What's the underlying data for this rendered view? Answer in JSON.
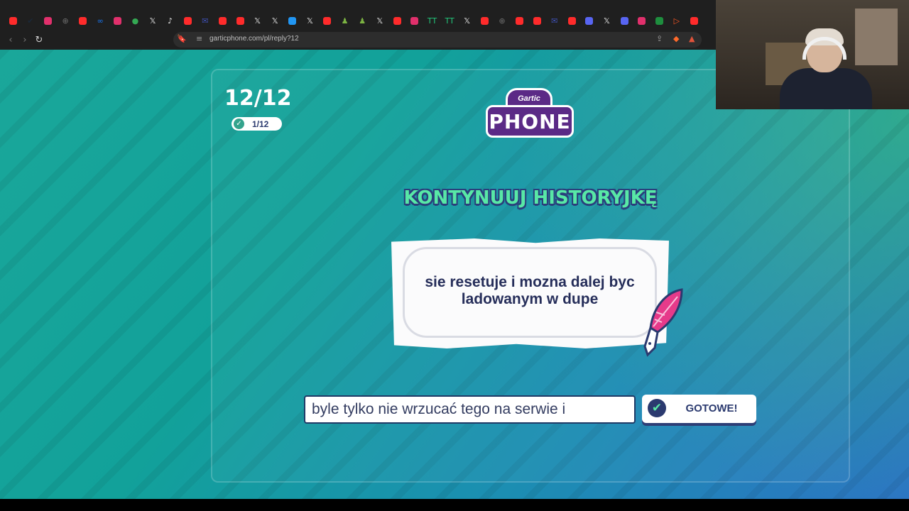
{
  "browser": {
    "url": "garticphone.com/pl/reply?12",
    "tab_favicons": [
      {
        "name": "youtube",
        "color": "#ff2b2b",
        "glyph": ""
      },
      {
        "name": "steam",
        "color": "#1b2838",
        "glyph": "✔"
      },
      {
        "name": "instagram",
        "color": "#e1306c",
        "glyph": ""
      },
      {
        "name": "globe",
        "color": "#6b6b6b",
        "glyph": "⊕"
      },
      {
        "name": "youtube",
        "color": "#ff2b2b",
        "glyph": ""
      },
      {
        "name": "meta",
        "color": "#1877f2",
        "glyph": "∞"
      },
      {
        "name": "instagram",
        "color": "#e1306c",
        "glyph": ""
      },
      {
        "name": "maps",
        "color": "#34a853",
        "glyph": "●"
      },
      {
        "name": "x",
        "color": "",
        "glyph": "𝕏"
      },
      {
        "name": "tiktok",
        "color": "",
        "glyph": "♪"
      },
      {
        "name": "youtube",
        "color": "#ff2b2b",
        "glyph": ""
      },
      {
        "name": "mail",
        "color": "#3f51b5",
        "glyph": "✉"
      },
      {
        "name": "youtube",
        "color": "#ff2b2b",
        "glyph": ""
      },
      {
        "name": "youtube",
        "color": "#ff2b2b",
        "glyph": ""
      },
      {
        "name": "x",
        "color": "",
        "glyph": "𝕏"
      },
      {
        "name": "x",
        "color": "",
        "glyph": "𝕏"
      },
      {
        "name": "app",
        "color": "#2196f3",
        "glyph": ""
      },
      {
        "name": "x",
        "color": "",
        "glyph": "𝕏"
      },
      {
        "name": "youtube",
        "color": "#ff2b2b",
        "glyph": ""
      },
      {
        "name": "chess",
        "color": "#7cb342",
        "glyph": "♟"
      },
      {
        "name": "chess",
        "color": "#7cb342",
        "glyph": "♟"
      },
      {
        "name": "x",
        "color": "",
        "glyph": "𝕏"
      },
      {
        "name": "youtube",
        "color": "#ff2b2b",
        "glyph": ""
      },
      {
        "name": "instagram",
        "color": "#e1306c",
        "glyph": ""
      },
      {
        "name": "tt",
        "color": "#22c77a",
        "glyph": "TT"
      },
      {
        "name": "tt",
        "color": "#22c77a",
        "glyph": "TT"
      },
      {
        "name": "x",
        "color": "",
        "glyph": "𝕏"
      },
      {
        "name": "youtube",
        "color": "#ff2b2b",
        "glyph": ""
      },
      {
        "name": "globe",
        "color": "#6b6b6b",
        "glyph": "⊕"
      },
      {
        "name": "youtube",
        "color": "#ff2b2b",
        "glyph": ""
      },
      {
        "name": "youtube",
        "color": "#ff2b2b",
        "glyph": ""
      },
      {
        "name": "mail",
        "color": "#3f51b5",
        "glyph": "✉"
      },
      {
        "name": "youtube",
        "color": "#ff2b2b",
        "glyph": ""
      },
      {
        "name": "discord",
        "color": "#5865f2",
        "glyph": ""
      },
      {
        "name": "x",
        "color": "",
        "glyph": "𝕏"
      },
      {
        "name": "discord",
        "color": "#5865f2",
        "glyph": ""
      },
      {
        "name": "instagram",
        "color": "#e1306c",
        "glyph": ""
      },
      {
        "name": "sheets",
        "color": "#1e8e3e",
        "glyph": ""
      },
      {
        "name": "play",
        "color": "#ff5722",
        "glyph": "▷"
      },
      {
        "name": "youtube",
        "color": "#ff2b2b",
        "glyph": ""
      }
    ]
  },
  "game": {
    "round": "12/12",
    "done_count": "1/12",
    "logo_top": "Gartic",
    "logo_bottom": "PHONE",
    "heading": "KONTYNUUJ HISTORYJKĘ",
    "prompt": "sie resetuje i mozna dalej byc ladowanym w dupe",
    "answer_value": "byle tylko nie wrzucać tego na serwie i",
    "done_button": "GOTOWE!"
  },
  "colors": {
    "accent_green": "#58e8a6",
    "navy": "#2b3a6f",
    "logo_purple": "#5b2a86",
    "feather_pink": "#e63a8a"
  }
}
